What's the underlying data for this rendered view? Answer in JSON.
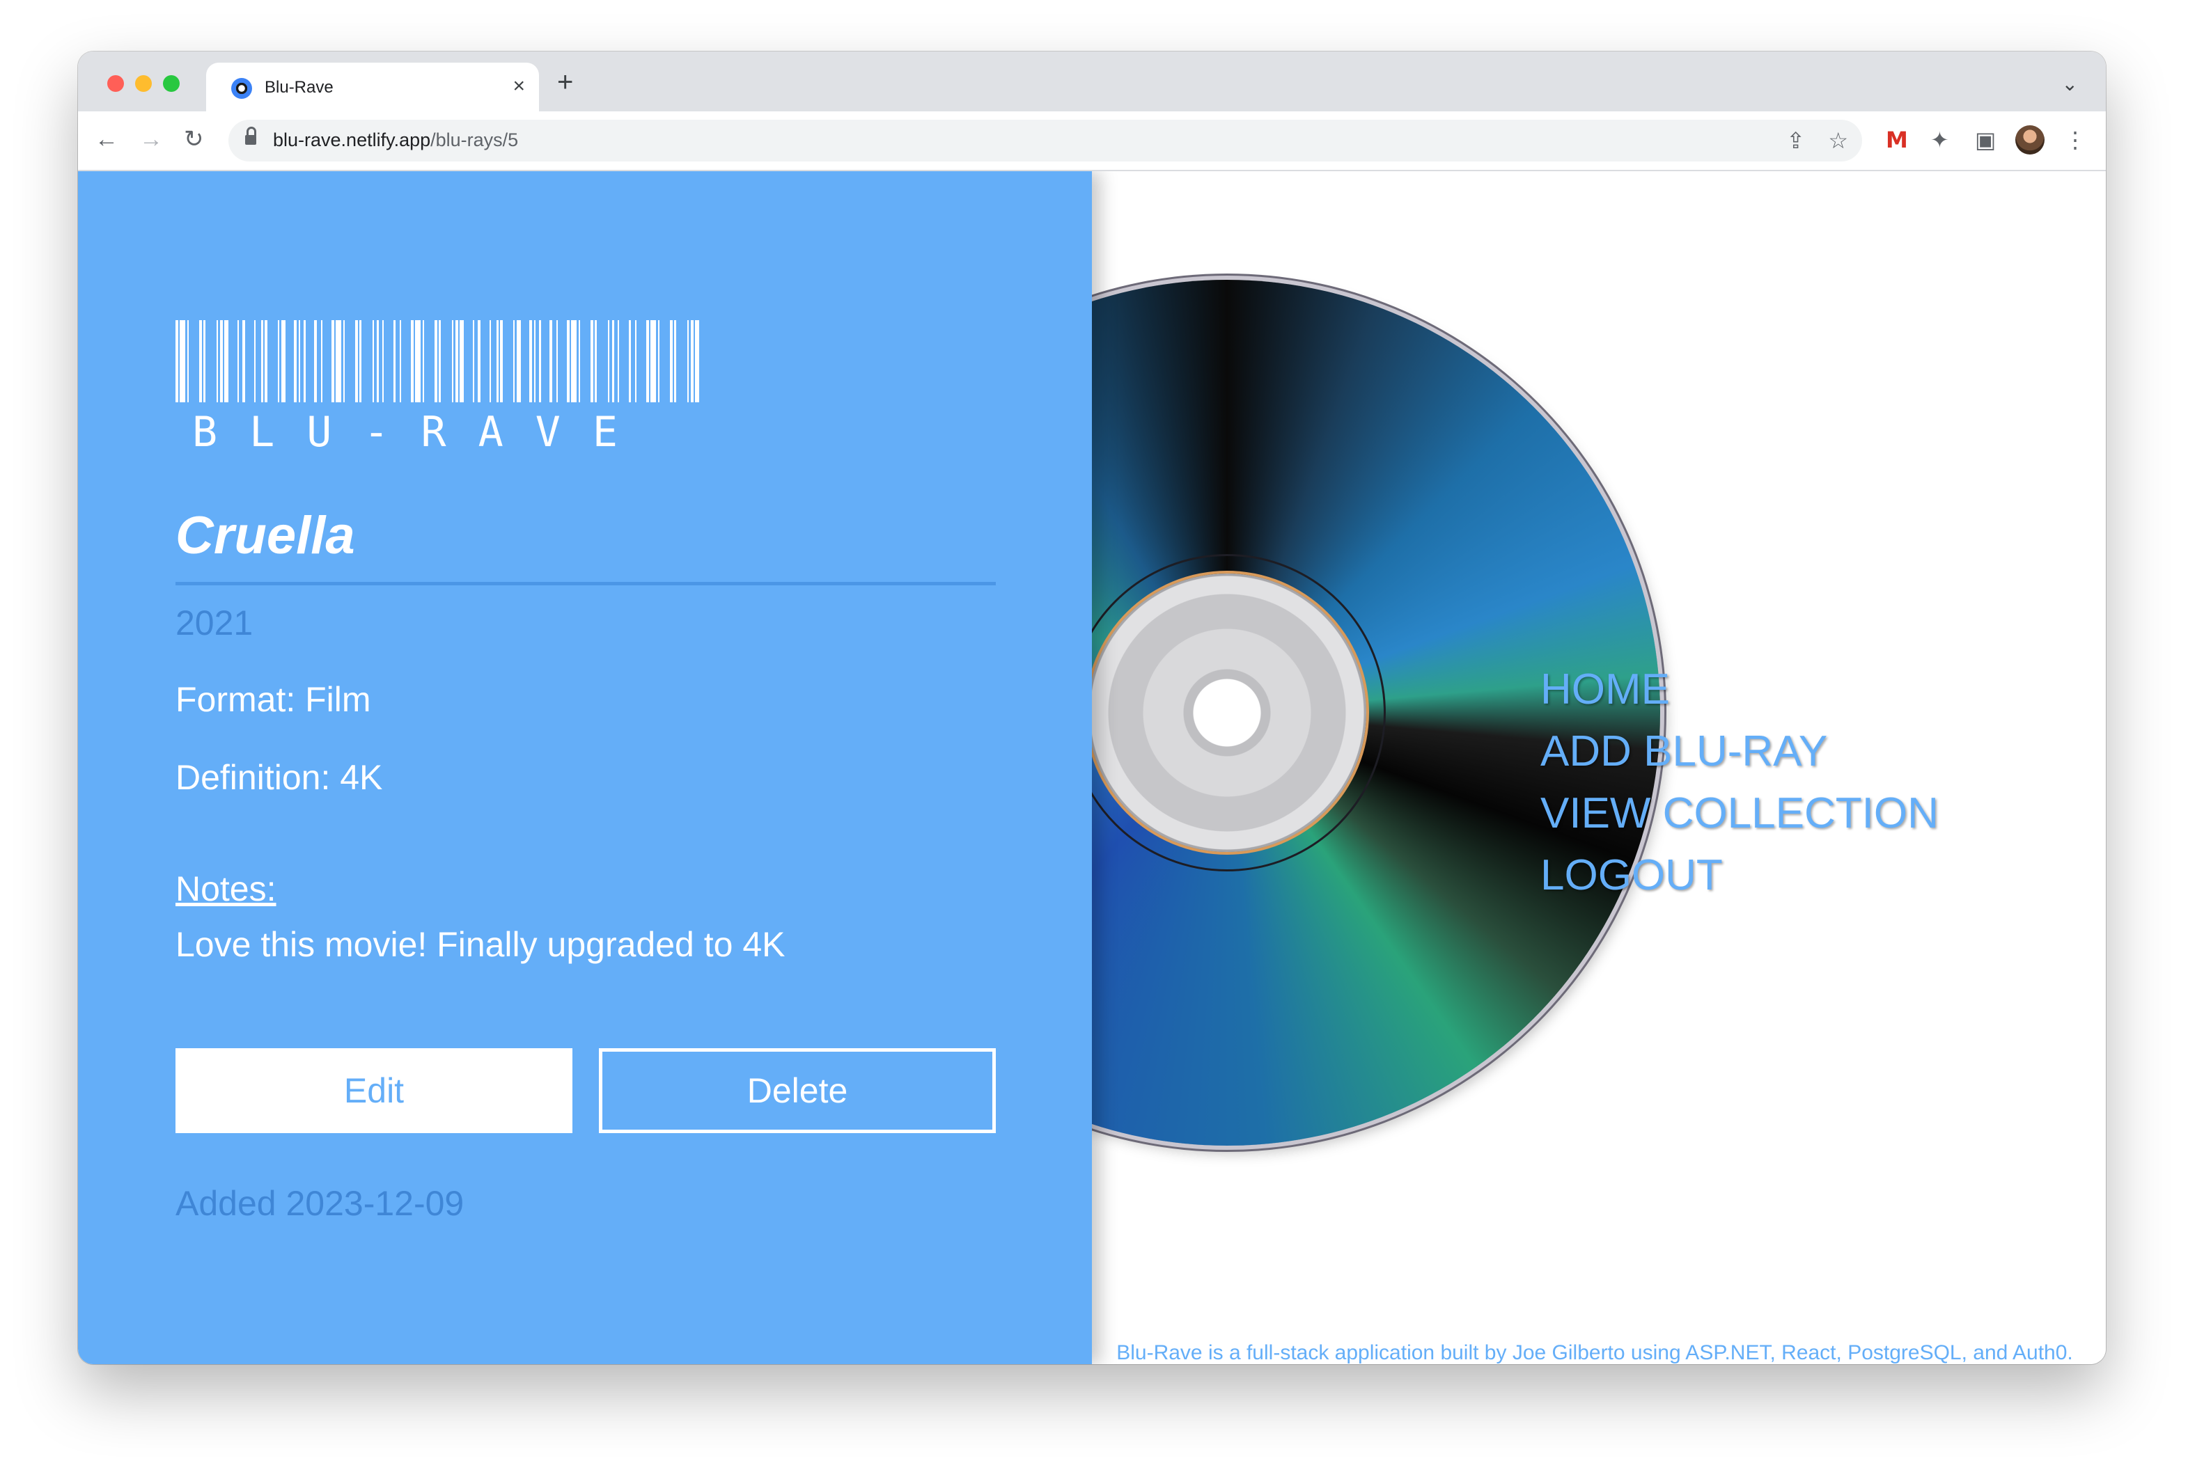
{
  "browser": {
    "tab_title": "Blu-Rave",
    "tab_close": "×",
    "new_tab": "+",
    "tab_dropdown": "⌄",
    "url_domain": "blu-rave.netlify.app",
    "url_path": "/blu-rays/5",
    "icons": {
      "back": "←",
      "forward": "→",
      "reload": "↻",
      "share": "⇪",
      "star": "☆",
      "gmail": "M",
      "extensions": "✦",
      "sidebar": "▣",
      "menu": "⋮"
    }
  },
  "logo": {
    "text": "BLU-RAVE"
  },
  "movie": {
    "title": "Cruella",
    "year": "2021",
    "format": "Format: Film",
    "definition": "Definition: 4K",
    "notes_label": "Notes:",
    "notes": "Love this movie! Finally upgraded to 4K",
    "added": "Added 2023-12-09"
  },
  "actions": {
    "edit": "Edit",
    "delete": "Delete"
  },
  "nav": {
    "home": "HOME",
    "add": "ADD BLU-RAY",
    "collection": "VIEW COLLECTION",
    "logout": "LOGOUT"
  },
  "footer": "Blu-Rave is a full-stack application built by Joe Gilberto using ASP.NET, React, PostgreSQL, and Auth0.",
  "colors": {
    "panel": "#64aef8",
    "accent_text": "#3f86d6",
    "white": "#ffffff"
  }
}
